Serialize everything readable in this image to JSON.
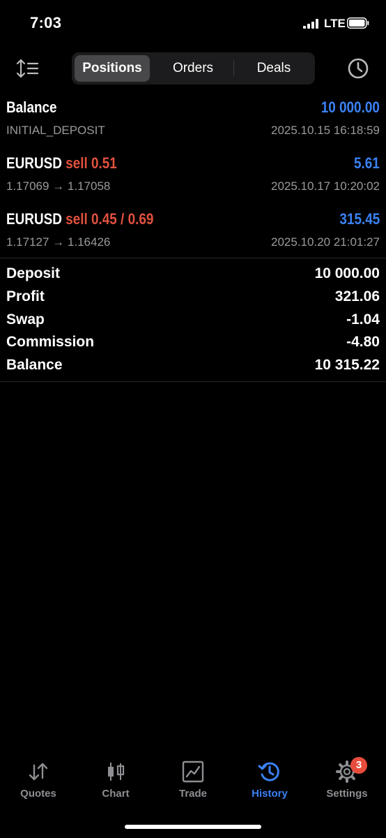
{
  "status": {
    "time": "7:03",
    "network": "LTE"
  },
  "segments": {
    "positions": "Positions",
    "orders": "Orders",
    "deals": "Deals"
  },
  "rows": [
    {
      "title": "Balance",
      "value": "10 000.00",
      "sub": "INITIAL_DEPOSIT",
      "time": "2025.10.15 16:18:59"
    },
    {
      "symbol": "EURUSD",
      "side": "sell 0.51",
      "value": "5.61",
      "sub": "1.17069 → 1.17058",
      "time": "2025.10.17 10:20:02"
    },
    {
      "symbol": "EURUSD",
      "side": "sell 0.45 / 0.69",
      "value": "315.45",
      "sub": "1.17127 → 1.16426",
      "time": "2025.10.20 21:01:27"
    }
  ],
  "summary": [
    {
      "label": "Deposit",
      "value": "10 000.00"
    },
    {
      "label": "Profit",
      "value": "321.06"
    },
    {
      "label": "Swap",
      "value": "-1.04"
    },
    {
      "label": "Commission",
      "value": "-4.80"
    },
    {
      "label": "Balance",
      "value": "10 315.22"
    }
  ],
  "tabs": [
    {
      "label": "Quotes",
      "icon": "quotes-icon"
    },
    {
      "label": "Chart",
      "icon": "chart-icon"
    },
    {
      "label": "Trade",
      "icon": "trade-icon"
    },
    {
      "label": "History",
      "icon": "history-icon",
      "active": true
    },
    {
      "label": "Settings",
      "icon": "gear-icon",
      "badge": "3"
    }
  ],
  "colors": {
    "accent": "#3b82f6",
    "sell": "#e2513f",
    "inactive": "#8e8e93",
    "badge": "#e74c3c"
  }
}
